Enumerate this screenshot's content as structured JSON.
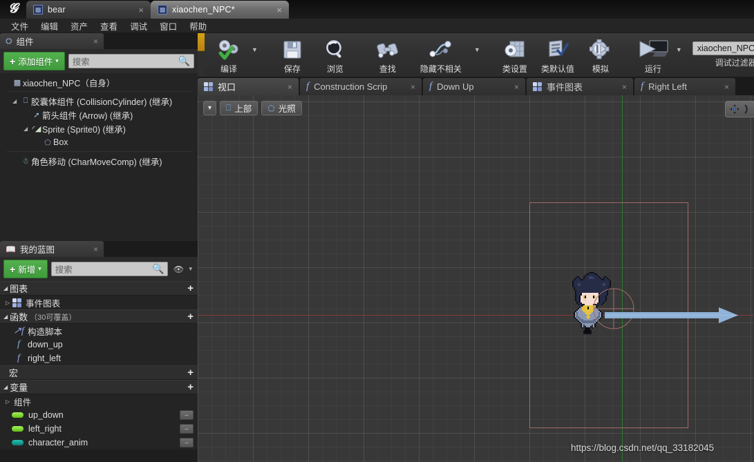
{
  "window": {
    "logo": "unreal-logo",
    "tabs": [
      {
        "label": "bear",
        "active": false,
        "icon": "blueprint-icon",
        "close": "×"
      },
      {
        "label": "xiaochen_NPC*",
        "active": true,
        "icon": "blueprint-icon",
        "close": "×"
      }
    ]
  },
  "menubar": {
    "items": [
      "文件",
      "编辑",
      "资产",
      "查看",
      "调试",
      "窗口",
      "帮助"
    ]
  },
  "toolbar": {
    "groups": [
      {
        "buttons": [
          {
            "label": "编译",
            "icon": "compile-icon",
            "dropdown": true
          }
        ]
      },
      {
        "buttons": [
          {
            "label": "保存",
            "icon": "save-icon",
            "dropdown": false
          },
          {
            "label": "浏览",
            "icon": "browse-icon",
            "dropdown": false
          }
        ]
      },
      {
        "buttons": [
          {
            "label": "查找",
            "icon": "find-icon",
            "dropdown": false
          },
          {
            "label": "隐藏不相关",
            "icon": "hide-unrelated-icon",
            "dropdown": true
          }
        ]
      },
      {
        "buttons": [
          {
            "label": "类设置",
            "icon": "class-settings-icon",
            "dropdown": false
          },
          {
            "label": "类默认值",
            "icon": "class-defaults-icon",
            "dropdown": false
          },
          {
            "label": "模拟",
            "icon": "simulate-icon",
            "dropdown": false
          }
        ]
      },
      {
        "buttons": [
          {
            "label": "运行",
            "icon": "play-icon",
            "dropdown": true
          }
        ]
      }
    ],
    "debug": {
      "combo_value": "xiaochen_NPC",
      "caret": "▼",
      "search_icon": "search-icon",
      "label": "调试过滤器"
    }
  },
  "components_panel": {
    "tab": {
      "label": "组件",
      "icon": "components-icon",
      "close": "×"
    },
    "add_button": {
      "label": "添加组件",
      "plus": "+",
      "caret": "▾"
    },
    "search": {
      "placeholder": "搜索",
      "icon": "search-icon"
    },
    "tree": [
      {
        "label": "xiaochen_NPC（自身）",
        "indent": 0,
        "icon": "blueprint-icon",
        "twisty": ""
      },
      {
        "separator": true
      },
      {
        "label": "胶囊体组件 (CollisionCylinder) (继承)",
        "indent": 1,
        "icon": "capsule-icon",
        "twisty": "◢"
      },
      {
        "label": "箭头组件 (Arrow) (继承)",
        "indent": 2,
        "icon": "arrow-icon",
        "twisty": ""
      },
      {
        "label": "Sprite (Sprite0) (继承)",
        "indent": 2,
        "icon": "sprite-icon",
        "twisty": "◢"
      },
      {
        "label": "Box",
        "indent": 3,
        "icon": "box-icon",
        "twisty": ""
      },
      {
        "separator": true
      },
      {
        "label": "角色移动 (CharMoveComp) (继承)",
        "indent": 1,
        "icon": "charmove-icon",
        "twisty": ""
      }
    ]
  },
  "myblueprint_panel": {
    "tab": {
      "label": "我的蓝图",
      "icon": "book-icon",
      "close": "×"
    },
    "add_button": {
      "label": "新增",
      "plus": "+",
      "caret": "▾"
    },
    "search": {
      "placeholder": "搜索",
      "icon": "search-icon"
    },
    "eye_icon": "eye-icon",
    "eye_caret": "▾",
    "sections": [
      {
        "title": "图表",
        "sub": "",
        "plus": "+",
        "tri": "◢",
        "rows": [
          {
            "label": "事件图表",
            "icon": "graph-icon",
            "tri": "▷"
          }
        ]
      },
      {
        "title": "函数",
        "sub": "（30可覆盖）",
        "plus": "+",
        "tri": "◢",
        "rows": [
          {
            "label": "构造脚本",
            "icon": "construction-script-icon"
          },
          {
            "label": "down_up",
            "icon": "function-icon"
          },
          {
            "label": "right_left",
            "icon": "function-icon"
          }
        ]
      },
      {
        "title": "宏",
        "sub": "",
        "plus": "+",
        "tri": "",
        "rows": []
      },
      {
        "title": "变量",
        "sub": "",
        "plus": "+",
        "tri": "◢",
        "rows": [
          {
            "label": "组件",
            "icon": "category-icon",
            "tri": "▷"
          },
          {
            "label": "up_down",
            "icon": "bool-pin-icon",
            "pill_color": "#7ddc2c",
            "chip": true
          },
          {
            "label": "left_right",
            "icon": "bool-pin-icon",
            "pill_color": "#7ddc2c",
            "chip": true
          },
          {
            "label": "character_anim",
            "icon": "object-pin-icon",
            "pill_color": "#17a89a",
            "chip": true
          }
        ]
      }
    ]
  },
  "document_tabs": [
    {
      "label": "视口",
      "icon": "viewport-icon",
      "selected": true,
      "close": "×"
    },
    {
      "label": "Construction Scrip",
      "icon": "function-icon",
      "selected": false,
      "close": "×"
    },
    {
      "label": "Down Up",
      "icon": "function-icon",
      "selected": false,
      "close": "×"
    },
    {
      "label": "事件图表",
      "icon": "graph-icon",
      "selected": false,
      "close": "×"
    },
    {
      "label": "Right Left",
      "icon": "function-icon",
      "selected": false,
      "close": "×"
    }
  ],
  "viewport": {
    "dropdown_caret": "▾",
    "view_button": {
      "label": "上部",
      "icon": "camera-icon"
    },
    "lit_button": {
      "label": "光照",
      "icon": "lit-cube-icon"
    },
    "gizmo_icons": [
      "translate-gizmo-icon",
      "rotate-gizmo-icon"
    ],
    "watermark": "https://blog.csdn.net/qq_33182045",
    "colors": {
      "background": "#383838",
      "axis_x": "#8a3a38",
      "axis_y": "#2f7a33",
      "selection_box": "#a06c6a",
      "gizmo_arrow": "#8fb2d8"
    }
  }
}
